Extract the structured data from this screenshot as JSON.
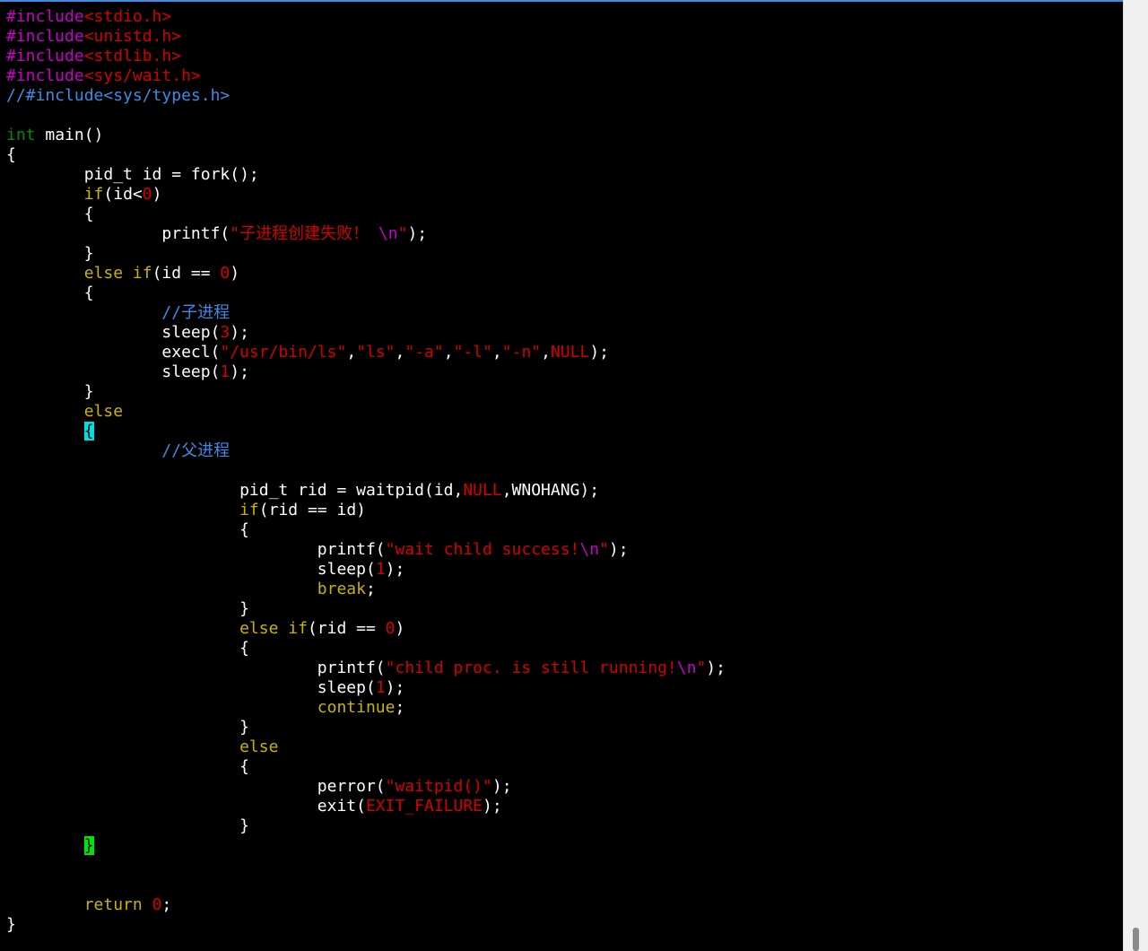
{
  "colors": {
    "background": "#000000",
    "default": "#ffffff",
    "preproc": "#c800c8",
    "include_path": "#d40000",
    "comment": "#3c8ce6",
    "type": "#008b00",
    "keyword": "#c8b400",
    "string": "#d40000",
    "number": "#d40000",
    "escape": "#c800c8",
    "cursor_bg": "#00e0e0",
    "match_bg": "#00e600",
    "bracket_fg": "#000000"
  },
  "lines": [
    [
      {
        "t": "#include",
        "c": "preproc"
      },
      {
        "t": "<stdio.h>",
        "c": "include_path"
      }
    ],
    [
      {
        "t": "#include",
        "c": "preproc"
      },
      {
        "t": "<unistd.h>",
        "c": "include_path"
      }
    ],
    [
      {
        "t": "#include",
        "c": "preproc"
      },
      {
        "t": "<stdlib.h>",
        "c": "include_path"
      }
    ],
    [
      {
        "t": "#include",
        "c": "preproc"
      },
      {
        "t": "<sys/wait.h>",
        "c": "include_path"
      }
    ],
    [
      {
        "t": "//#include<sys/types.h>",
        "c": "comment"
      }
    ],
    [],
    [
      {
        "t": "int",
        "c": "type"
      },
      {
        "t": " main()",
        "c": "default"
      }
    ],
    [
      {
        "t": "{",
        "c": "default"
      }
    ],
    [
      {
        "t": "        pid_t id = fork();",
        "c": "default"
      }
    ],
    [
      {
        "t": "        ",
        "c": "default"
      },
      {
        "t": "if",
        "c": "keyword"
      },
      {
        "t": "(id<",
        "c": "default"
      },
      {
        "t": "0",
        "c": "number"
      },
      {
        "t": ")",
        "c": "default"
      }
    ],
    [
      {
        "t": "        {",
        "c": "default"
      }
    ],
    [
      {
        "t": "                printf(",
        "c": "default"
      },
      {
        "t": "\"子进程创建失败！ ",
        "c": "string"
      },
      {
        "t": "\\n",
        "c": "escape"
      },
      {
        "t": "\"",
        "c": "string"
      },
      {
        "t": ");",
        "c": "default"
      }
    ],
    [
      {
        "t": "        }",
        "c": "default"
      }
    ],
    [
      {
        "t": "        ",
        "c": "default"
      },
      {
        "t": "else if",
        "c": "keyword"
      },
      {
        "t": "(id == ",
        "c": "default"
      },
      {
        "t": "0",
        "c": "number"
      },
      {
        "t": ")",
        "c": "default"
      }
    ],
    [
      {
        "t": "        {",
        "c": "default"
      }
    ],
    [
      {
        "t": "                ",
        "c": "default"
      },
      {
        "t": "//子进程",
        "c": "comment"
      }
    ],
    [
      {
        "t": "                sleep(",
        "c": "default"
      },
      {
        "t": "3",
        "c": "number"
      },
      {
        "t": ");",
        "c": "default"
      }
    ],
    [
      {
        "t": "                execl(",
        "c": "default"
      },
      {
        "t": "\"/usr/bin/ls\"",
        "c": "string"
      },
      {
        "t": ",",
        "c": "default"
      },
      {
        "t": "\"ls\"",
        "c": "string"
      },
      {
        "t": ",",
        "c": "default"
      },
      {
        "t": "\"-a\"",
        "c": "string"
      },
      {
        "t": ",",
        "c": "default"
      },
      {
        "t": "\"-l\"",
        "c": "string"
      },
      {
        "t": ",",
        "c": "default"
      },
      {
        "t": "\"-n\"",
        "c": "string"
      },
      {
        "t": ",",
        "c": "default"
      },
      {
        "t": "NULL",
        "c": "number"
      },
      {
        "t": ");",
        "c": "default"
      }
    ],
    [
      {
        "t": "                sleep(",
        "c": "default"
      },
      {
        "t": "1",
        "c": "number"
      },
      {
        "t": ");",
        "c": "default"
      }
    ],
    [
      {
        "t": "        }",
        "c": "default"
      }
    ],
    [
      {
        "t": "        ",
        "c": "default"
      },
      {
        "t": "else",
        "c": "keyword"
      }
    ],
    [
      {
        "t": "        ",
        "c": "default"
      },
      {
        "t": "{",
        "c": "cursor"
      }
    ],
    [
      {
        "t": "                ",
        "c": "default"
      },
      {
        "t": "//父进程",
        "c": "comment"
      }
    ],
    [],
    [
      {
        "t": "                        pid_t rid = waitpid(id,",
        "c": "default"
      },
      {
        "t": "NULL",
        "c": "number"
      },
      {
        "t": ",WNOHANG);",
        "c": "default"
      }
    ],
    [
      {
        "t": "                        ",
        "c": "default"
      },
      {
        "t": "if",
        "c": "keyword"
      },
      {
        "t": "(rid == id)",
        "c": "default"
      }
    ],
    [
      {
        "t": "                        {",
        "c": "default"
      }
    ],
    [
      {
        "t": "                                printf(",
        "c": "default"
      },
      {
        "t": "\"wait child success!",
        "c": "string"
      },
      {
        "t": "\\n",
        "c": "escape"
      },
      {
        "t": "\"",
        "c": "string"
      },
      {
        "t": ");",
        "c": "default"
      }
    ],
    [
      {
        "t": "                                sleep(",
        "c": "default"
      },
      {
        "t": "1",
        "c": "number"
      },
      {
        "t": ");",
        "c": "default"
      }
    ],
    [
      {
        "t": "                                ",
        "c": "default"
      },
      {
        "t": "break",
        "c": "keyword"
      },
      {
        "t": ";",
        "c": "default"
      }
    ],
    [
      {
        "t": "                        }",
        "c": "default"
      }
    ],
    [
      {
        "t": "                        ",
        "c": "default"
      },
      {
        "t": "else if",
        "c": "keyword"
      },
      {
        "t": "(rid == ",
        "c": "default"
      },
      {
        "t": "0",
        "c": "number"
      },
      {
        "t": ")",
        "c": "default"
      }
    ],
    [
      {
        "t": "                        {",
        "c": "default"
      }
    ],
    [
      {
        "t": "                                printf(",
        "c": "default"
      },
      {
        "t": "\"child proc. is still running!",
        "c": "string"
      },
      {
        "t": "\\n",
        "c": "escape"
      },
      {
        "t": "\"",
        "c": "string"
      },
      {
        "t": ");",
        "c": "default"
      }
    ],
    [
      {
        "t": "                                sleep(",
        "c": "default"
      },
      {
        "t": "1",
        "c": "number"
      },
      {
        "t": ");",
        "c": "default"
      }
    ],
    [
      {
        "t": "                                ",
        "c": "default"
      },
      {
        "t": "continue",
        "c": "keyword"
      },
      {
        "t": ";",
        "c": "default"
      }
    ],
    [
      {
        "t": "                        }",
        "c": "default"
      }
    ],
    [
      {
        "t": "                        ",
        "c": "default"
      },
      {
        "t": "else",
        "c": "keyword"
      }
    ],
    [
      {
        "t": "                        {",
        "c": "default"
      }
    ],
    [
      {
        "t": "                                perror(",
        "c": "default"
      },
      {
        "t": "\"waitpid()\"",
        "c": "string"
      },
      {
        "t": ");",
        "c": "default"
      }
    ],
    [
      {
        "t": "                                exit(",
        "c": "default"
      },
      {
        "t": "EXIT_FAILURE",
        "c": "number"
      },
      {
        "t": ");",
        "c": "default"
      }
    ],
    [
      {
        "t": "                        }",
        "c": "default"
      }
    ],
    [
      {
        "t": "        ",
        "c": "default"
      },
      {
        "t": "}",
        "c": "match"
      }
    ],
    [],
    [],
    [
      {
        "t": "        ",
        "c": "default"
      },
      {
        "t": "return",
        "c": "keyword"
      },
      {
        "t": " ",
        "c": "default"
      },
      {
        "t": "0",
        "c": "number"
      },
      {
        "t": ";",
        "c": "default"
      }
    ],
    [
      {
        "t": "}",
        "c": "default"
      }
    ]
  ]
}
